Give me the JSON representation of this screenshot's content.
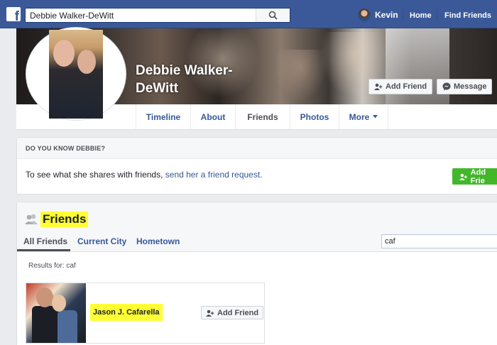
{
  "topbar": {
    "search_value": "Debbie Walker-DeWitt",
    "user_name": "Kevin",
    "home_label": "Home",
    "find_friends_label": "Find Friends"
  },
  "profile": {
    "name_line1": "Debbie Walker-",
    "name_line2": "DeWitt",
    "add_friend_label": "Add Friend",
    "message_label": "Message"
  },
  "timeline_tabs": [
    {
      "label": "Timeline"
    },
    {
      "label": "About"
    },
    {
      "label": "Friends",
      "active": true
    },
    {
      "label": "Photos"
    },
    {
      "label": "More"
    }
  ],
  "know_panel": {
    "heading": "DO YOU KNOW DEBBIE?",
    "text": "To see what she shares with friends, ",
    "link": "send her a friend request.",
    "button_label": "Add Frie"
  },
  "friends_panel": {
    "title": "Friends",
    "tabs": [
      {
        "label": "All Friends",
        "active": true
      },
      {
        "label": "Current City"
      },
      {
        "label": "Hometown"
      }
    ],
    "search_value": "caf",
    "results_label": "Results for: caf",
    "results": [
      {
        "name": "Jason J. Cafarella",
        "button_label": "Add Friend"
      }
    ]
  },
  "colors": {
    "brand": "#3b5998",
    "link": "#365899",
    "highlight": "#ffff33",
    "green": "#42b72a"
  },
  "icons": [
    "facebook-logo-icon",
    "search-icon",
    "add-friend-icon",
    "messenger-icon",
    "friends-icon",
    "caret-down-icon"
  ]
}
